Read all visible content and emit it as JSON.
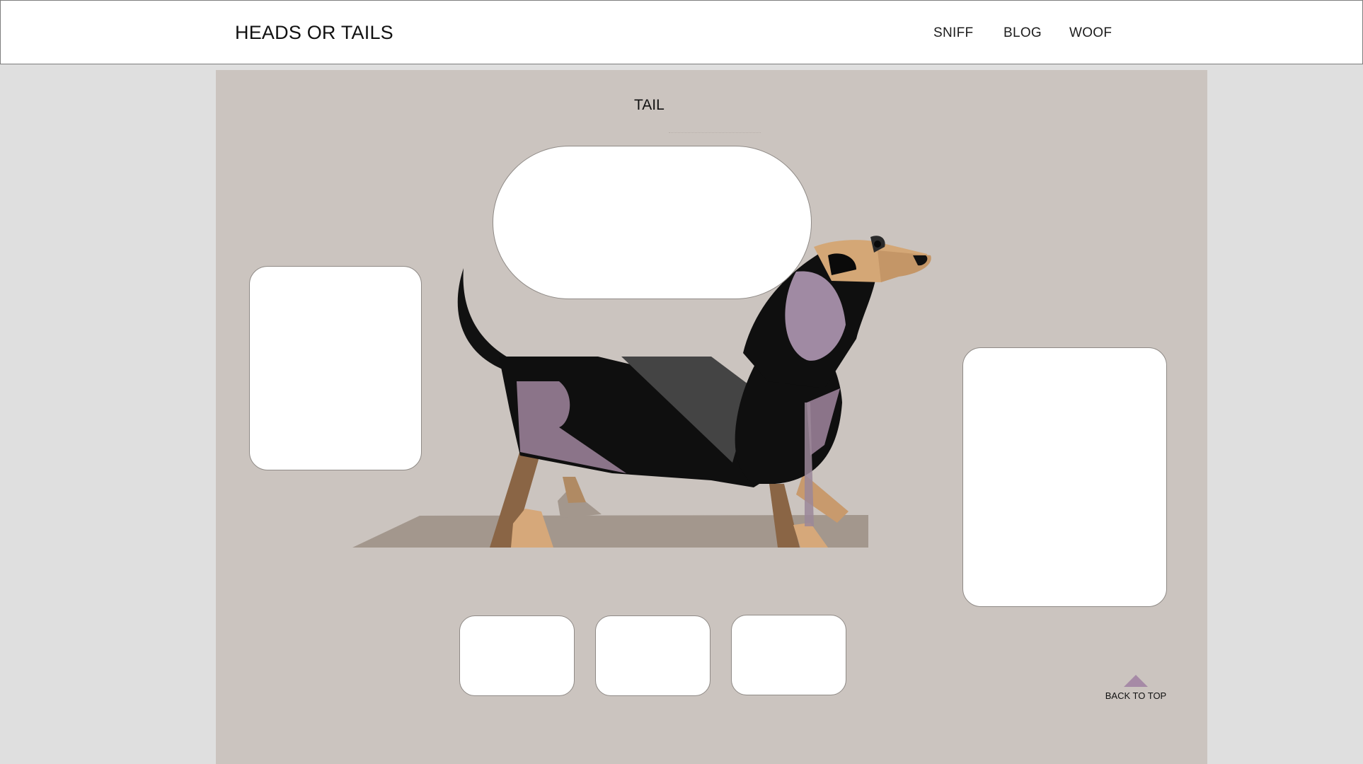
{
  "header": {
    "logo": "HEADS OR TAILS",
    "nav": [
      "SNIFF",
      "BLOG",
      "WOOF"
    ]
  },
  "main": {
    "title": "TAIL",
    "back_to_top": "BACK TO TOP",
    "back_to_top_icon": "triangle-up-icon"
  },
  "colors": {
    "page_bg": "#dfdfdf",
    "panel_bg": "#cbc4bf",
    "accent_lavender": "#a68aa6",
    "card_bg": "#ffffff"
  }
}
